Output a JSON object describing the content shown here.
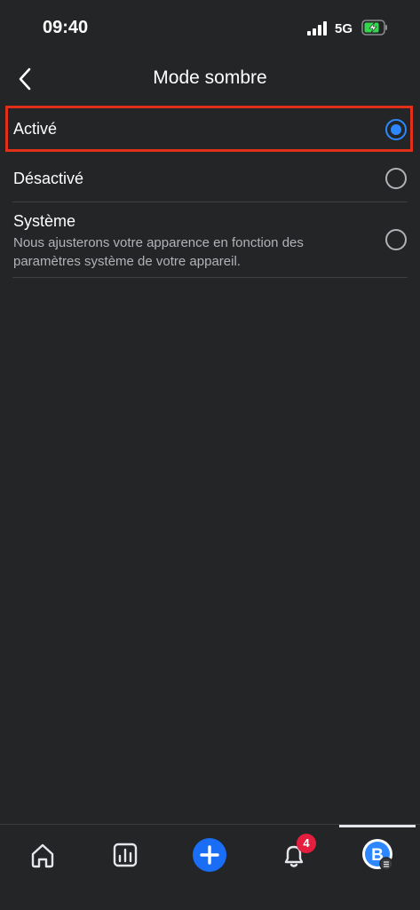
{
  "status_bar": {
    "time": "09:40",
    "network": "5G",
    "signal_icon": "signal-bars-icon",
    "battery_icon": "battery-charging-icon"
  },
  "header": {
    "title": "Mode sombre",
    "back_icon": "chevron-left-icon"
  },
  "options": [
    {
      "label": "Activé",
      "description": "",
      "selected": true
    },
    {
      "label": "Désactivé",
      "description": "",
      "selected": false
    },
    {
      "label": "Système",
      "description": "Nous ajusterons votre apparence en fonction des paramètres système de votre appareil.",
      "selected": false
    }
  ],
  "tab_bar": {
    "tabs": [
      {
        "name": "home",
        "icon": "home-icon"
      },
      {
        "name": "stats",
        "icon": "chart-icon"
      },
      {
        "name": "create",
        "icon": "plus-icon"
      },
      {
        "name": "notifications",
        "icon": "bell-icon",
        "badge": "4"
      },
      {
        "name": "profile",
        "icon": "avatar-icon",
        "active": true
      }
    ]
  },
  "colors": {
    "background": "#242526",
    "accent": "#2d88ff",
    "highlight": "#e1301a",
    "badge": "#e41e3f"
  }
}
